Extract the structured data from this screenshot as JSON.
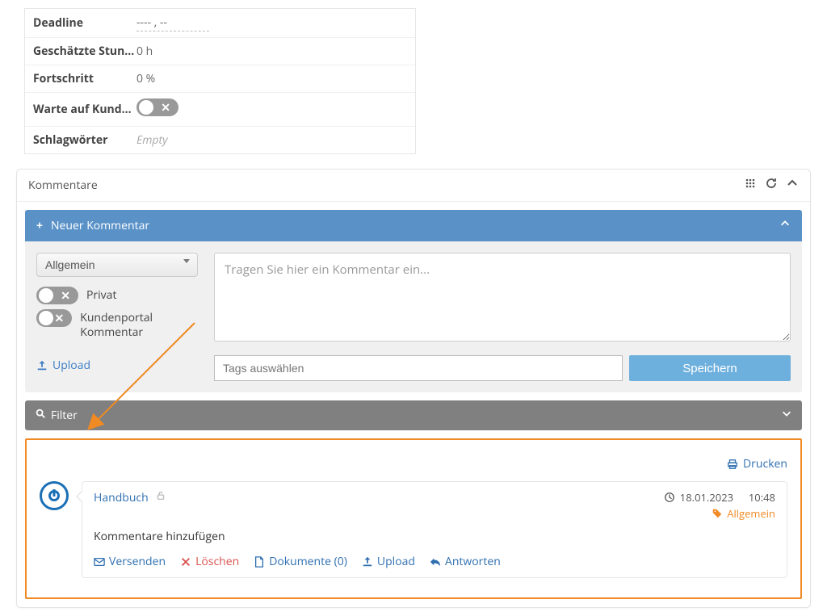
{
  "details": {
    "deadline_label": "Deadline",
    "deadline_value": "----            , --",
    "hours_label": "Geschätzte Stun…",
    "hours_value": "0 h",
    "progress_label": "Fortschritt",
    "progress_value": "0 %",
    "wait_label": "Warte auf Kunde…",
    "tags_label": "Schlagwörter",
    "tags_value": "Empty"
  },
  "panel": {
    "title": "Kommentare",
    "new_comment": "Neuer Kommentar"
  },
  "form": {
    "category": "Allgemein",
    "privat_label": "Privat",
    "portal_label": "Kundenportal Kommentar",
    "upload_label": "Upload",
    "textarea_placeholder": "Tragen Sie hier ein Kommentar ein...",
    "tags_placeholder": "Tags auswählen",
    "save_label": "Speichern"
  },
  "filter": {
    "label": "Filter"
  },
  "print": {
    "label": "Drucken"
  },
  "comment": {
    "author": "Handbuch",
    "date": "18.01.2023",
    "time": "10:48",
    "tag": "Allgemein",
    "text": "Kommentare hinzufügen",
    "send": "Versenden",
    "delete": "Löschen",
    "documents": "Dokumente (0)",
    "upload": "Upload",
    "reply": "Antworten"
  }
}
